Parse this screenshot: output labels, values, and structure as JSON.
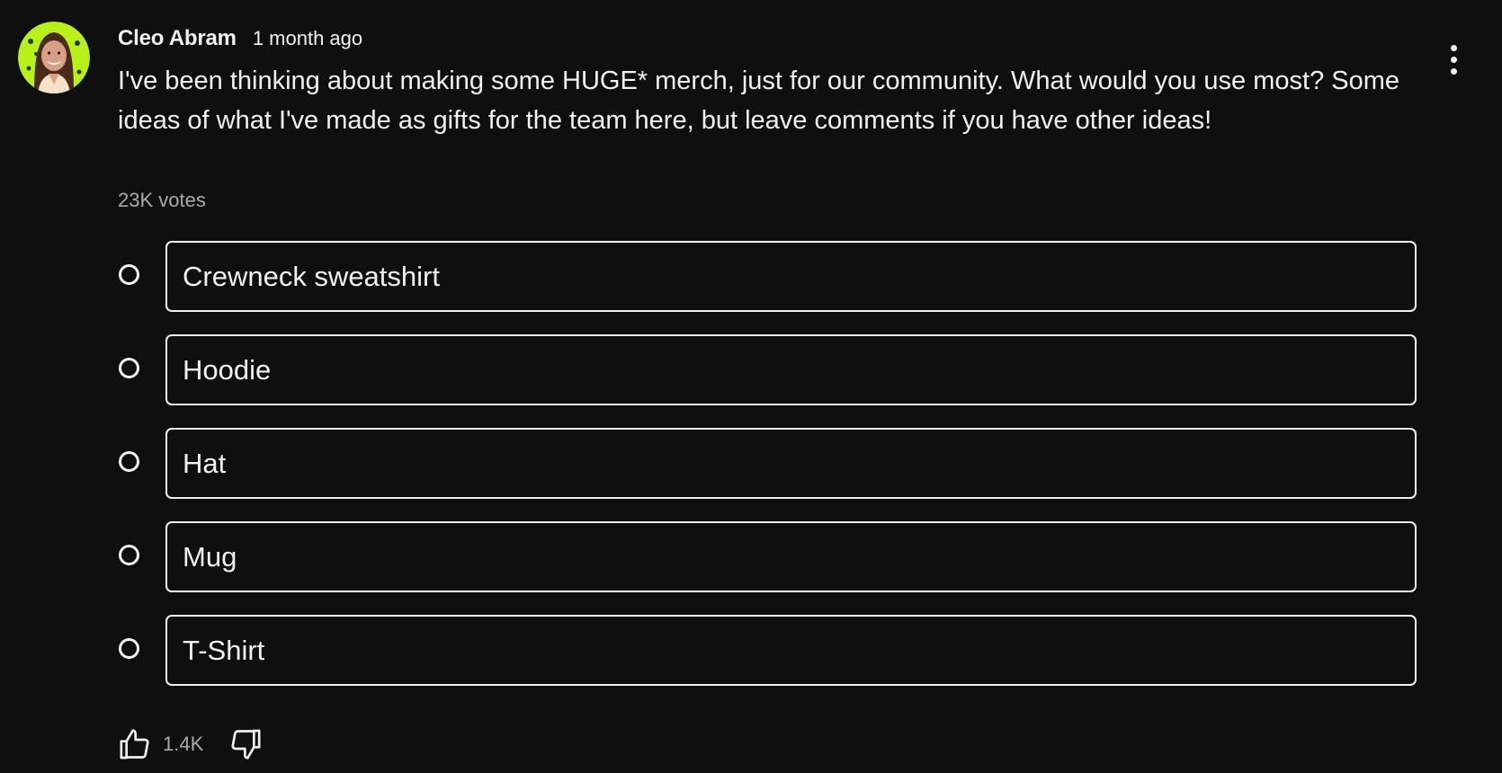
{
  "post": {
    "author": "Cleo Abram",
    "time": "1 month ago",
    "text": "I've been thinking about making some HUGE* merch, just for our community. What would you use most? Some ideas of what I've made as gifts for the team here, but leave comments if you have other ideas!",
    "votes": "23K votes"
  },
  "poll": {
    "options": [
      {
        "label": "Crewneck sweatshirt"
      },
      {
        "label": "Hoodie"
      },
      {
        "label": "Hat"
      },
      {
        "label": "Mug"
      },
      {
        "label": "T-Shirt"
      }
    ]
  },
  "actions": {
    "like_count": "1.4K",
    "like_icon": "thumbs-up-icon",
    "dislike_icon": "thumbs-down-icon",
    "menu_icon": "more-vertical-icon"
  },
  "colors": {
    "background": "#0f0f0f",
    "text": "#f1f1f1",
    "secondary_text": "#aaaaaa",
    "avatar_ring": "#b8f01a"
  }
}
